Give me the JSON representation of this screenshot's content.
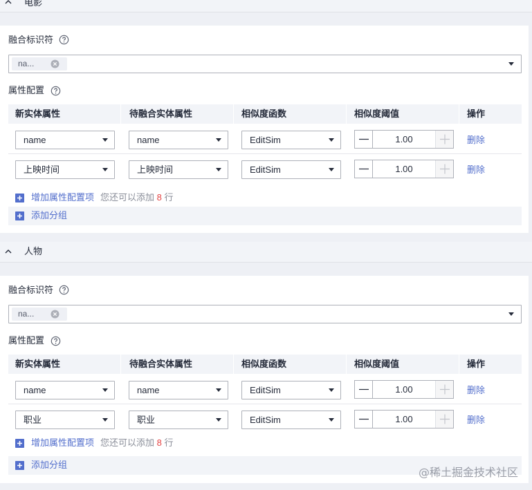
{
  "groups": [
    {
      "title": "电影",
      "fusion_identifier_label": "融合标识符",
      "fusion_tags": [
        "na..."
      ],
      "attr_config_label": "属性配置",
      "columns": [
        "新实体属性",
        "待融合实体属性",
        "相似度函数",
        "相似度阈值",
        "操作"
      ],
      "rows": [
        {
          "new_attr": "name",
          "merge_attr": "name",
          "func": "EditSim",
          "threshold": "1.00",
          "action": "删除"
        },
        {
          "new_attr": "上映时间",
          "merge_attr": "上映时间",
          "func": "EditSim",
          "threshold": "1.00",
          "action": "删除"
        }
      ],
      "add_attr_label": "增加属性配置项",
      "hint_prefix": "您还可以添加",
      "hint_count": "8",
      "hint_suffix": "行",
      "add_group_label": "添加分组"
    },
    {
      "title": "人物",
      "fusion_identifier_label": "融合标识符",
      "fusion_tags": [
        "na..."
      ],
      "attr_config_label": "属性配置",
      "columns": [
        "新实体属性",
        "待融合实体属性",
        "相似度函数",
        "相似度阈值",
        "操作"
      ],
      "rows": [
        {
          "new_attr": "name",
          "merge_attr": "name",
          "func": "EditSim",
          "threshold": "1.00",
          "action": "删除"
        },
        {
          "new_attr": "职业",
          "merge_attr": "职业",
          "func": "EditSim",
          "threshold": "1.00",
          "action": "删除"
        }
      ],
      "add_attr_label": "增加属性配置项",
      "hint_prefix": "您还可以添加",
      "hint_count": "8",
      "hint_suffix": "行",
      "add_group_label": "添加分组"
    }
  ],
  "watermark": "@稀土掘金技术社区",
  "colors": {
    "accent": "#526ecc",
    "danger": "#e54545",
    "border": "#adb0b8",
    "panel": "#f2f4f8"
  }
}
